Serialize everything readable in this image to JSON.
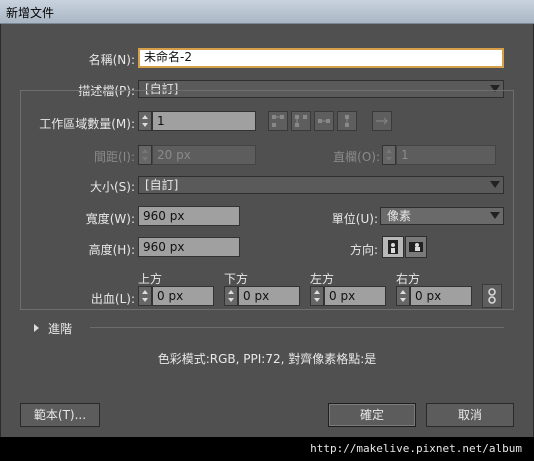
{
  "window": {
    "title": "新增文件"
  },
  "form": {
    "name_label": "名稱(N):",
    "name_value": "未命名-2",
    "profile_label": "描述檔(P):",
    "profile_value": "[自訂]",
    "artboards_label": "工作區域數量(M):",
    "artboards_value": "1",
    "spacing_label": "間距(I):",
    "spacing_value": "20 px",
    "columns_label": "直欄(O):",
    "columns_value": "1",
    "size_label": "大小(S):",
    "size_value": "[自訂]",
    "width_label": "寬度(W):",
    "width_value": "960 px",
    "units_label": "單位(U):",
    "units_value": "像素",
    "height_label": "高度(H):",
    "height_value": "960 px",
    "orientation_label": "方向:",
    "bleed_label": "出血(L):",
    "bleed": [
      {
        "label": "上方",
        "value": "0 px"
      },
      {
        "label": "下方",
        "value": "0 px"
      },
      {
        "label": "左方",
        "value": "0 px"
      },
      {
        "label": "右方",
        "value": "0 px"
      }
    ],
    "advanced_label": "進階",
    "summary": "色彩模式:RGB, PPI:72, 對齊像素格點:是"
  },
  "buttons": {
    "templates": "範本(T)...",
    "ok": "確定",
    "cancel": "取消"
  },
  "watermark": "http://makelive.pixnet.net/album",
  "colors": {
    "dialog_bg": "#505050",
    "name_focus": "#d6a04a",
    "field_bg": "#a0a0a0"
  },
  "icons": [
    "arrange-grid-by-row-icon",
    "arrange-grid-by-column-icon",
    "arrange-by-row-icon",
    "arrange-by-column-icon",
    "right-to-left-layout-icon",
    "portrait-orientation-icon",
    "landscape-orientation-icon",
    "link-bleed-icon"
  ]
}
